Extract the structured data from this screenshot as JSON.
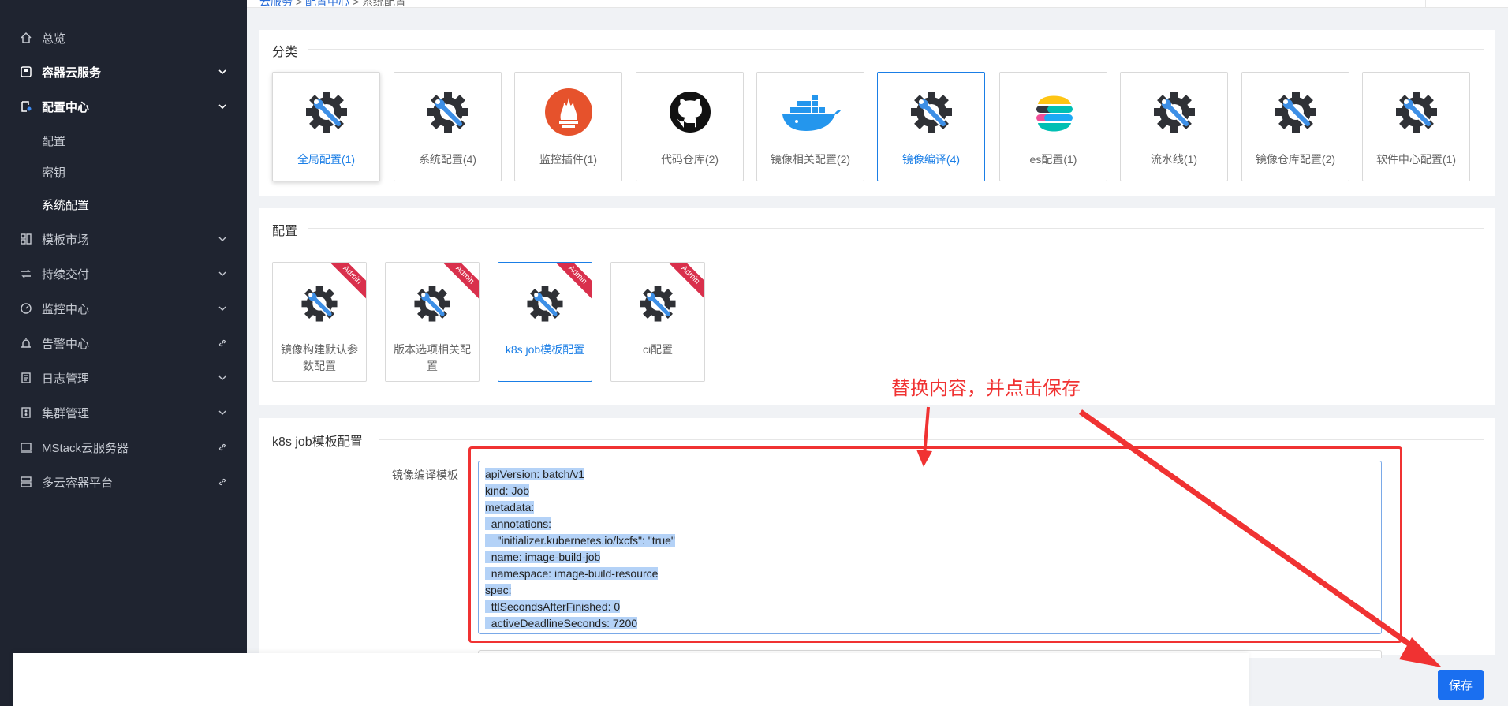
{
  "sidebar": {
    "items": [
      {
        "label": "总览",
        "icon": "home-icon"
      },
      {
        "label": "容器云服务",
        "icon": "cube-icon"
      },
      {
        "label": "配置中心",
        "icon": "config-icon"
      },
      {
        "label": "模板市场",
        "icon": "template-icon"
      },
      {
        "label": "持续交付",
        "icon": "delivery-icon"
      },
      {
        "label": "监控中心",
        "icon": "monitor-icon"
      },
      {
        "label": "告警中心",
        "icon": "alarm-icon"
      },
      {
        "label": "日志管理",
        "icon": "log-icon"
      },
      {
        "label": "集群管理",
        "icon": "cluster-icon"
      },
      {
        "label": "MStack云服务器",
        "icon": "server-icon"
      },
      {
        "label": "多云容器平台",
        "icon": "multicloud-icon"
      }
    ],
    "sub_items": [
      "配置",
      "密钥",
      "系统配置"
    ]
  },
  "breadcrumb": {
    "root": "云服务",
    "sep": ">",
    "mid": "配置中心",
    "current": "系统配置"
  },
  "category": {
    "title": "分类",
    "cards": [
      {
        "label": "全局配置(1)",
        "icon": "gear-wrench-icon"
      },
      {
        "label": "系统配置(4)",
        "icon": "gear-wrench-icon"
      },
      {
        "label": "监控插件(1)",
        "icon": "prometheus-icon"
      },
      {
        "label": "代码仓库(2)",
        "icon": "github-icon"
      },
      {
        "label": "镜像相关配置(2)",
        "icon": "docker-icon"
      },
      {
        "label": "镜像编译(4)",
        "icon": "gear-wrench-icon"
      },
      {
        "label": "es配置(1)",
        "icon": "elastic-icon"
      },
      {
        "label": "流水线(1)",
        "icon": "gear-wrench-icon"
      },
      {
        "label": "镜像仓库配置(2)",
        "icon": "gear-wrench-icon"
      },
      {
        "label": "软件中心配置(1)",
        "icon": "gear-wrench-icon"
      }
    ]
  },
  "config": {
    "title": "配置",
    "badge": "Admin",
    "cards": [
      {
        "label": "镜像构建默认参数配置"
      },
      {
        "label": "版本选项相关配置"
      },
      {
        "label": "k8s job模板配置"
      },
      {
        "label": "ci配置"
      }
    ]
  },
  "detail": {
    "title": "k8s job模板配置",
    "field_label": "镜像编译模板",
    "lines": [
      "apiVersion: batch/v1",
      "kind: Job",
      "metadata:",
      "  annotations:",
      "    \"initializer.kubernetes.io/lxcfs\": \"true\"",
      "  name: image-build-job",
      "  namespace: image-build-resource",
      "spec:",
      "  ttlSecondsAfterFinished: 0",
      "  activeDeadlineSeconds: 7200"
    ]
  },
  "annotation": "替换内容，并点击保存",
  "footer": {
    "save_label": "保存"
  },
  "colors": {
    "accent": "#1a7ee6",
    "sidebar_bg": "#1f2430",
    "annotation_red": "#f03232",
    "admin_ribbon": "#d9304c"
  }
}
